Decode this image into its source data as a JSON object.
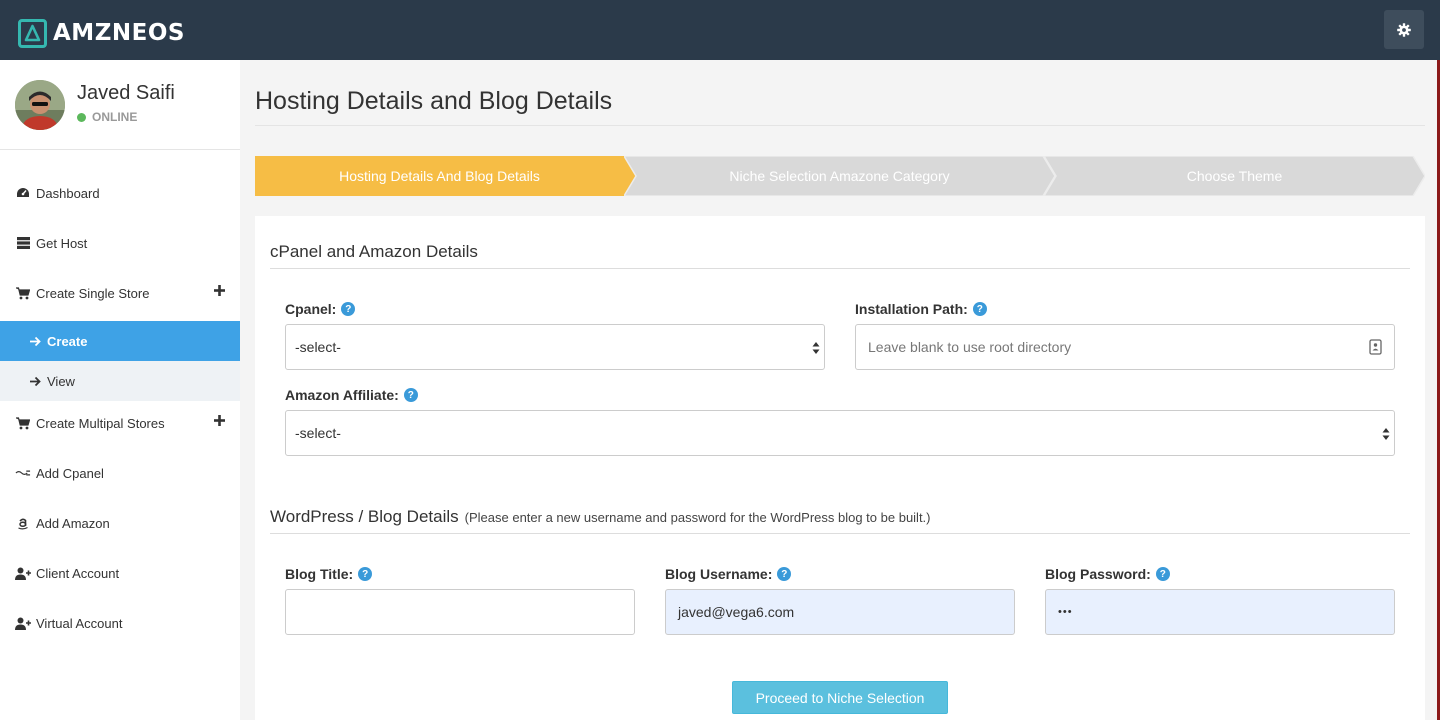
{
  "brand": {
    "name": "AMZNEOS"
  },
  "user": {
    "name": "Javed Saifi",
    "status": "ONLINE"
  },
  "sidebar": {
    "items": [
      {
        "label": "Dashboard",
        "icon": "dashboard-icon"
      },
      {
        "label": "Get Host",
        "icon": "server-icon"
      },
      {
        "label": "Create Single Store",
        "icon": "cart-icon",
        "expand": "+"
      },
      {
        "label": "Create",
        "icon": "arrow-right-icon",
        "active": true
      },
      {
        "label": "View",
        "icon": "arrow-right-icon"
      },
      {
        "label": "Create Multipal Stores",
        "icon": "cart-icon",
        "expand": "+"
      },
      {
        "label": "Add Cpanel",
        "icon": "cpanel-icon"
      },
      {
        "label": "Add Amazon",
        "icon": "amazon-icon"
      },
      {
        "label": "Client Account",
        "icon": "user-plus-icon"
      },
      {
        "label": "Virtual Account",
        "icon": "user-plus-icon"
      }
    ]
  },
  "page": {
    "title": "Hosting Details and Blog Details"
  },
  "steps": [
    {
      "label": "Hosting Details And Blog Details",
      "active": true
    },
    {
      "label": "Niche Selection Amazone Category",
      "active": false
    },
    {
      "label": "Choose Theme",
      "active": false
    }
  ],
  "cpanel_section": {
    "title": "cPanel and Amazon Details",
    "cpanel_label": "Cpanel:",
    "cpanel_value": "-select-",
    "path_label": "Installation Path:",
    "path_placeholder": "Leave blank to use root directory",
    "affiliate_label": "Amazon Affiliate:",
    "affiliate_value": "-select-"
  },
  "blog_section": {
    "title": "WordPress / Blog Details",
    "note": "(Please enter a new username and password for the WordPress blog to be built.)",
    "title_label": "Blog Title:",
    "title_value": "",
    "username_label": "Blog Username:",
    "username_value": "javed@vega6.com",
    "password_label": "Blog Password:",
    "password_value": "•••"
  },
  "actions": {
    "proceed": "Proceed to Niche Selection"
  },
  "help_glyph": "?",
  "colors": {
    "topbar": "#2b3a4a",
    "accent": "#3ea2e6",
    "step_active": "#f6bd45",
    "step_inactive": "#d9d9d9",
    "button": "#5bc0de",
    "teal": "#35b8b0"
  }
}
